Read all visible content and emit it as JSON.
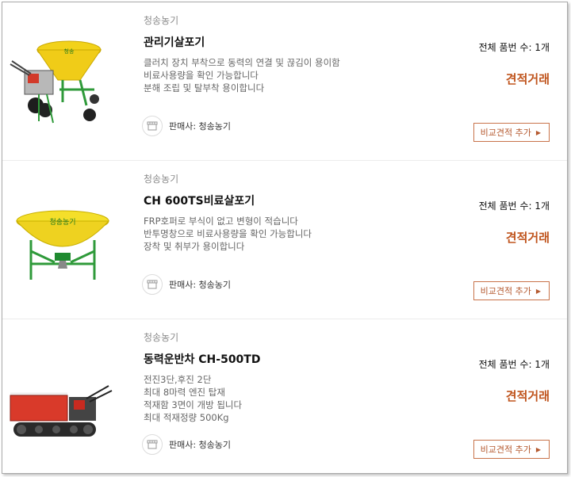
{
  "products": [
    {
      "brand": "청송농기",
      "title": "관리기살포기",
      "desc": [
        "클러치 장치 부착으로 동력의 연결 및 끊김이 용이함",
        "비료사용량을 확인 가능합니다",
        "분해 조립 및 탈부착 용이합니다"
      ],
      "seller": "판매사: 청송농기",
      "count": "전체 품번 수: 1개",
      "quote": "견적거래",
      "compare": "비교견적 추가",
      "image_icon": "tiller-spreader-image"
    },
    {
      "brand": "청송농기",
      "title": "CH 600TS비료살포기",
      "desc": [
        "FRP호퍼로 부식이 없고 변형이 적습니다",
        "반투명창으로 비료사용량을 확인 가능합니다",
        "장착 및 취부가 용이합니다"
      ],
      "seller": "판매사: 청송농기",
      "count": "전체 품번 수: 1개",
      "quote": "견적거래",
      "compare": "비교견적 추가",
      "image_icon": "fertilizer-spreader-image"
    },
    {
      "brand": "청송농기",
      "title": "동력운반차 CH-500TD",
      "desc": [
        "전진3단,후진 2단",
        "최대 8마력 엔진 탑재",
        "적재함 3면이 개방 됩니다",
        "최대 적재정량 500Kg"
      ],
      "seller": "판매사: 청송농기",
      "count": "전체 품번 수: 1개",
      "quote": "견적거래",
      "compare": "비교견적 추가",
      "image_icon": "crawler-carrier-image"
    }
  ],
  "colors": {
    "accent": "#c0551e",
    "button_border": "#c8734a",
    "muted": "#8c8c8c"
  }
}
